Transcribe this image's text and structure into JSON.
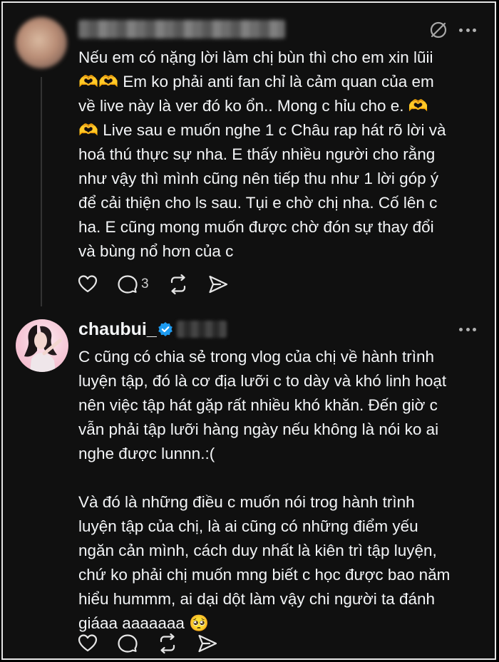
{
  "post1": {
    "more_icon": "more-horizontal-icon",
    "translate_icon": "translate-off-icon",
    "text": "Nếu em có nặng lời làm chị bùn thì cho em xin lũii\n🫶🫶 Em ko phải anti fan chỉ là cảm quan của em\nvề live này là ver đó ko ổn.. Mong c hỉu cho e. 🫶\n🫶 Live sau e muốn nghe 1 c Châu rap hát rõ lời và\nhoá thú thực sự nha. E thấy nhiều người cho rằng\nnhư vậy thì mình cũng nên tiếp thu như  1 lời góp ý\nđể cải thiện cho ls sau. Tụi e chờ chị nha. Cố lên c\nha. E cũng mong muốn được chờ đón sự thay đổi\nvà bùng nổ hơn của c",
    "actions": {
      "like_icon": "heart-icon",
      "reply_icon": "comment-icon",
      "reply_count": "3",
      "repost_icon": "repost-icon",
      "share_icon": "send-icon"
    }
  },
  "post2": {
    "username": "chaubui_",
    "verified_icon": "verified-badge-icon",
    "text": "C cũng có chia sẻ trong vlog của chị về hành trình\nluyện tập, đó là cơ địa lưỡi c to dày và khó linh hoạt\nnên việc tập hát gặp rất nhiều khó khăn. Đến giờ c\nvẫn phải tập lưỡi hàng ngày nếu không là nói ko ai\nnghe được lunnn.:(\n\nVà đó là những điều c muốn nói trog hành trình\nluyện tập của chị, là ai cũng có những điểm yếu\nngăn cản mình, cách duy nhất là kiên trì tập luyện,\nchứ ko phải chị muốn mng biết c học được bao năm\nhiểu hummm, ai dại dột làm vậy chi người ta đánh\ngiáaa aaaaaaa 🥺",
    "actions": {
      "like_icon": "heart-icon",
      "reply_icon": "comment-icon",
      "repost_icon": "repost-icon",
      "share_icon": "send-icon"
    }
  },
  "colors": {
    "background": "#101010",
    "text": "#f3f5f7",
    "muted": "#b0b0b0",
    "verified": "#1d9bf0"
  }
}
